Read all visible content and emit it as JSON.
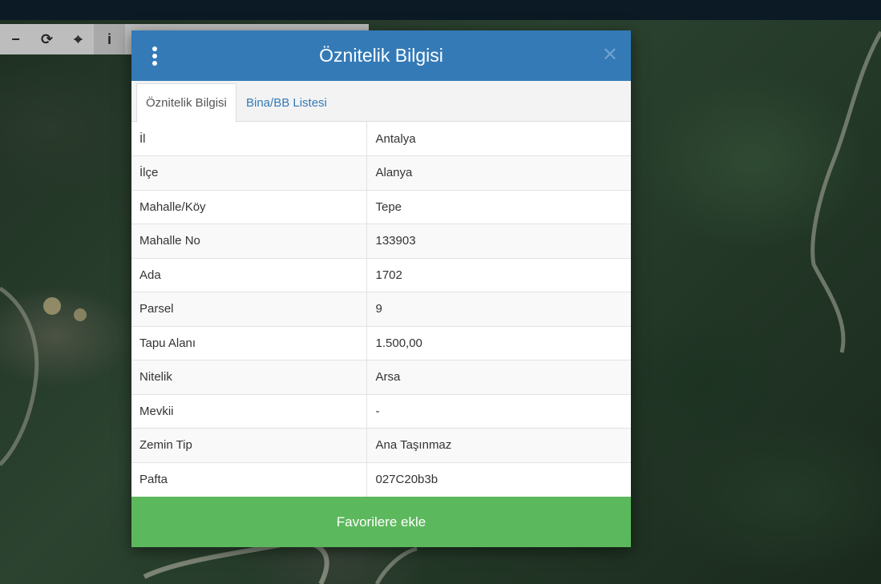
{
  "modal": {
    "title": "Öznitelik Bilgisi",
    "tabs": [
      {
        "label": "Öznitelik Bilgisi",
        "active": true
      },
      {
        "label": "Bina/BB Listesi",
        "active": false
      }
    ],
    "rows": [
      {
        "key": "İl",
        "value": "Antalya"
      },
      {
        "key": "İlçe",
        "value": "Alanya"
      },
      {
        "key": "Mahalle/Köy",
        "value": "Tepe"
      },
      {
        "key": "Mahalle No",
        "value": "133903"
      },
      {
        "key": "Ada",
        "value": "1702"
      },
      {
        "key": "Parsel",
        "value": "9"
      },
      {
        "key": "Tapu Alanı",
        "value": "1.500,00"
      },
      {
        "key": "Nitelik",
        "value": "Arsa"
      },
      {
        "key": "Mevkii",
        "value": "-"
      },
      {
        "key": "Zemin Tip",
        "value": "Ana Taşınmaz"
      },
      {
        "key": "Pafta",
        "value": "027C20b3b"
      }
    ],
    "favorite_button": "Favorilere ekle"
  },
  "toolbar": {
    "icons": [
      "minus-icon",
      "refresh-icon",
      "crosshair-icon",
      "info-icon"
    ],
    "glyphs": [
      "−",
      "⟳",
      "⌖",
      "i"
    ]
  },
  "colors": {
    "header": "#337ab7",
    "button": "#5cb85c",
    "link": "#337ab7"
  }
}
